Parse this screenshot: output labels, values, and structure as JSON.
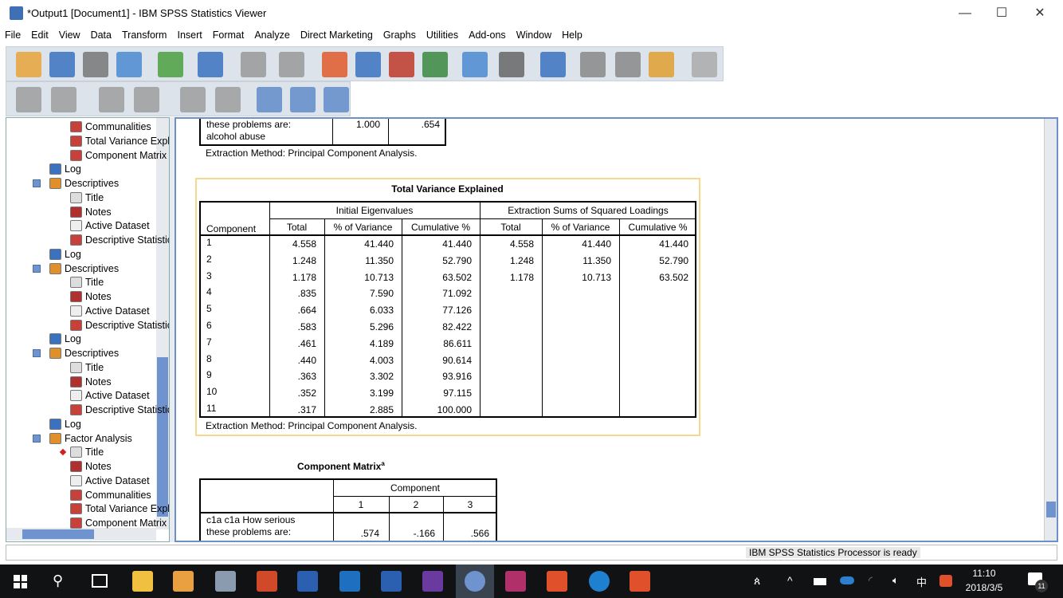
{
  "window": {
    "title": "*Output1 [Document1] - IBM SPSS Statistics Viewer",
    "minimize": "—",
    "maximize": "☐",
    "close": "✕"
  },
  "menu": [
    "File",
    "Edit",
    "View",
    "Data",
    "Transform",
    "Insert",
    "Format",
    "Analyze",
    "Direct Marketing",
    "Graphs",
    "Utilities",
    "Add-ons",
    "Window",
    "Help"
  ],
  "outline": [
    {
      "label": "Communalities",
      "level": 2,
      "icon": "table-icon"
    },
    {
      "label": "Total Variance Explained",
      "level": 2,
      "icon": "table-icon"
    },
    {
      "label": "Component Matrix",
      "level": 2,
      "icon": "table-icon"
    },
    {
      "label": "Log",
      "level": 1,
      "icon": "log-icon"
    },
    {
      "label": "Descriptives",
      "level": 1,
      "icon": "procedure-icon",
      "expand": "−"
    },
    {
      "label": "Title",
      "level": 2,
      "icon": "title-icon"
    },
    {
      "label": "Notes",
      "level": 2,
      "icon": "notes-icon"
    },
    {
      "label": "Active Dataset",
      "level": 2,
      "icon": "dataset-icon"
    },
    {
      "label": "Descriptive Statistics",
      "level": 2,
      "icon": "table-icon"
    },
    {
      "label": "Log",
      "level": 1,
      "icon": "log-icon"
    },
    {
      "label": "Descriptives",
      "level": 1,
      "icon": "procedure-icon",
      "expand": "−"
    },
    {
      "label": "Title",
      "level": 2,
      "icon": "title-icon"
    },
    {
      "label": "Notes",
      "level": 2,
      "icon": "notes-icon"
    },
    {
      "label": "Active Dataset",
      "level": 2,
      "icon": "dataset-icon"
    },
    {
      "label": "Descriptive Statistics",
      "level": 2,
      "icon": "table-icon"
    },
    {
      "label": "Log",
      "level": 1,
      "icon": "log-icon"
    },
    {
      "label": "Descriptives",
      "level": 1,
      "icon": "procedure-icon",
      "expand": "−"
    },
    {
      "label": "Title",
      "level": 2,
      "icon": "title-icon"
    },
    {
      "label": "Notes",
      "level": 2,
      "icon": "notes-icon"
    },
    {
      "label": "Active Dataset",
      "level": 2,
      "icon": "dataset-icon"
    },
    {
      "label": "Descriptive Statistics",
      "level": 2,
      "icon": "table-icon"
    },
    {
      "label": "Log",
      "level": 1,
      "icon": "log-icon"
    },
    {
      "label": "Factor Analysis",
      "level": 1,
      "icon": "procedure-icon",
      "expand": "−"
    },
    {
      "label": "Title",
      "level": 2,
      "icon": "title-icon",
      "current": true
    },
    {
      "label": "Notes",
      "level": 2,
      "icon": "notes-icon"
    },
    {
      "label": "Active Dataset",
      "level": 2,
      "icon": "dataset-icon"
    },
    {
      "label": "Communalities",
      "level": 2,
      "icon": "table-icon"
    },
    {
      "label": "Total Variance Explained",
      "level": 2,
      "icon": "table-icon"
    },
    {
      "label": "Component Matrix",
      "level": 2,
      "icon": "table-icon"
    }
  ],
  "communalities_tail": {
    "row_label_partial": "these problems are:",
    "row_label": "alcohol abuse",
    "initial": "1.000",
    "extraction": ".654",
    "footnote": "Extraction Method: Principal Component Analysis."
  },
  "tve": {
    "title": "Total Variance Explained",
    "component_header": "Component",
    "group1": "Initial Eigenvalues",
    "group2": "Extraction Sums of Squared Loadings",
    "subheaders": [
      "Total",
      "% of Variance",
      "Cumulative %",
      "Total",
      "% of Variance",
      "Cumulative %"
    ],
    "rows": [
      [
        "1",
        "4.558",
        "41.440",
        "41.440",
        "4.558",
        "41.440",
        "41.440"
      ],
      [
        "2",
        "1.248",
        "11.350",
        "52.790",
        "1.248",
        "11.350",
        "52.790"
      ],
      [
        "3",
        "1.178",
        "10.713",
        "63.502",
        "1.178",
        "10.713",
        "63.502"
      ],
      [
        "4",
        ".835",
        "7.590",
        "71.092",
        "",
        "",
        ""
      ],
      [
        "5",
        ".664",
        "6.033",
        "77.126",
        "",
        "",
        ""
      ],
      [
        "6",
        ".583",
        "5.296",
        "82.422",
        "",
        "",
        ""
      ],
      [
        "7",
        ".461",
        "4.189",
        "86.611",
        "",
        "",
        ""
      ],
      [
        "8",
        ".440",
        "4.003",
        "90.614",
        "",
        "",
        ""
      ],
      [
        "9",
        ".363",
        "3.302",
        "93.916",
        "",
        "",
        ""
      ],
      [
        "10",
        ".352",
        "3.199",
        "97.115",
        "",
        "",
        ""
      ],
      [
        "11",
        ".317",
        "2.885",
        "100.000",
        "",
        "",
        ""
      ]
    ],
    "footnote": "Extraction Method: Principal Component Analysis."
  },
  "cm": {
    "title": "Component Matrix",
    "sup": "a",
    "group": "Component",
    "cols": [
      "1",
      "2",
      "3"
    ],
    "row_label1": "c1a c1a How serious",
    "row_label2": "these problems are:",
    "values": [
      ".574",
      "-.166",
      ".566"
    ]
  },
  "status": {
    "processor": "IBM SPSS Statistics Processor is ready"
  },
  "taskbar": {
    "time": "11:10",
    "date": "2018/3/5",
    "notifications": "11",
    "ime": "中"
  }
}
